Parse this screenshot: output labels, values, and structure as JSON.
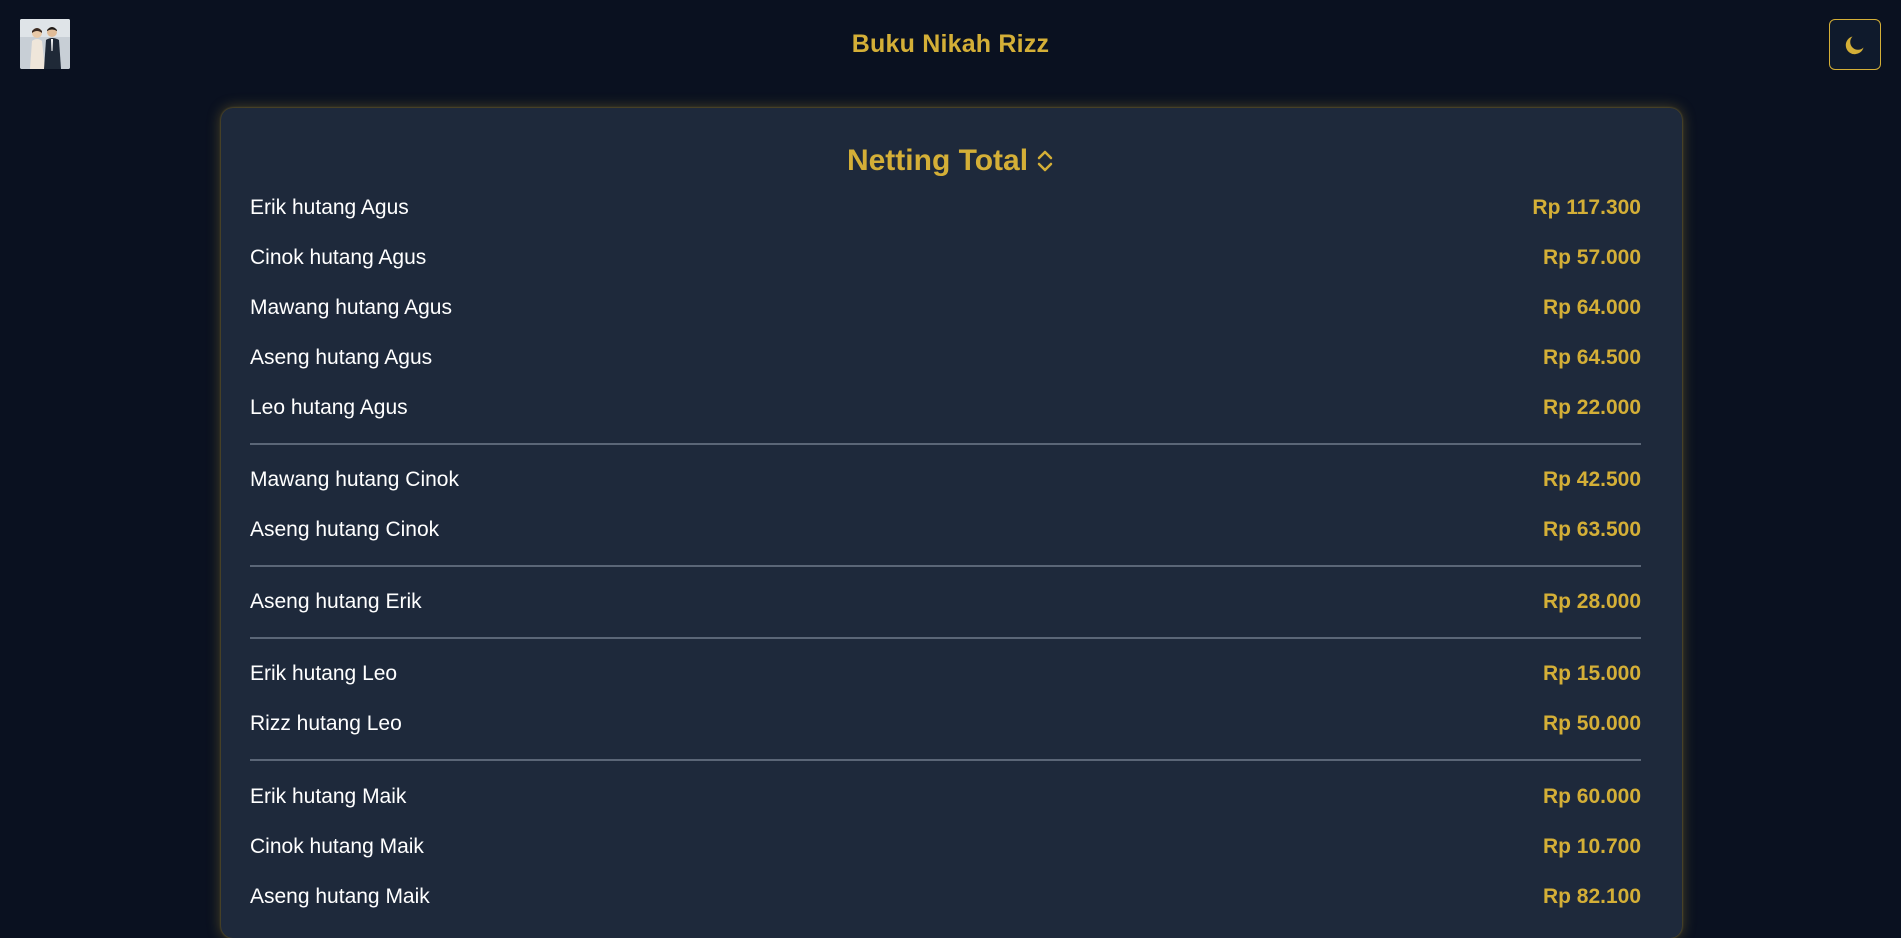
{
  "header": {
    "title": "Buku Nikah Rizz",
    "avatar_icon": "couple-photo",
    "theme_icon": "moon-icon"
  },
  "card": {
    "title": "Netting Total",
    "sort_icon": "chevron-up-down-icon"
  },
  "colors": {
    "background": "#0a1120",
    "card": "#1e293b",
    "accent": "#d4af37",
    "text": "#ffffff",
    "divider": "#5b6677"
  },
  "groups": [
    {
      "creditor": "Agus",
      "rows": [
        {
          "label": "Erik hutang Agus",
          "amount": "Rp 117.300"
        },
        {
          "label": "Cinok hutang Agus",
          "amount": "Rp 57.000"
        },
        {
          "label": "Mawang hutang Agus",
          "amount": "Rp 64.000"
        },
        {
          "label": "Aseng hutang Agus",
          "amount": "Rp 64.500"
        },
        {
          "label": "Leo hutang Agus",
          "amount": "Rp 22.000"
        }
      ]
    },
    {
      "creditor": "Cinok",
      "rows": [
        {
          "label": "Mawang hutang Cinok",
          "amount": "Rp 42.500"
        },
        {
          "label": "Aseng hutang Cinok",
          "amount": "Rp 63.500"
        }
      ]
    },
    {
      "creditor": "Erik",
      "rows": [
        {
          "label": "Aseng hutang Erik",
          "amount": "Rp 28.000"
        }
      ]
    },
    {
      "creditor": "Leo",
      "rows": [
        {
          "label": "Erik hutang Leo",
          "amount": "Rp 15.000"
        },
        {
          "label": "Rizz hutang Leo",
          "amount": "Rp 50.000"
        }
      ]
    },
    {
      "creditor": "Maik",
      "rows": [
        {
          "label": "Erik hutang Maik",
          "amount": "Rp 60.000"
        },
        {
          "label": "Cinok hutang Maik",
          "amount": "Rp 10.700"
        },
        {
          "label": "Aseng hutang Maik",
          "amount": "Rp 82.100"
        }
      ]
    }
  ]
}
